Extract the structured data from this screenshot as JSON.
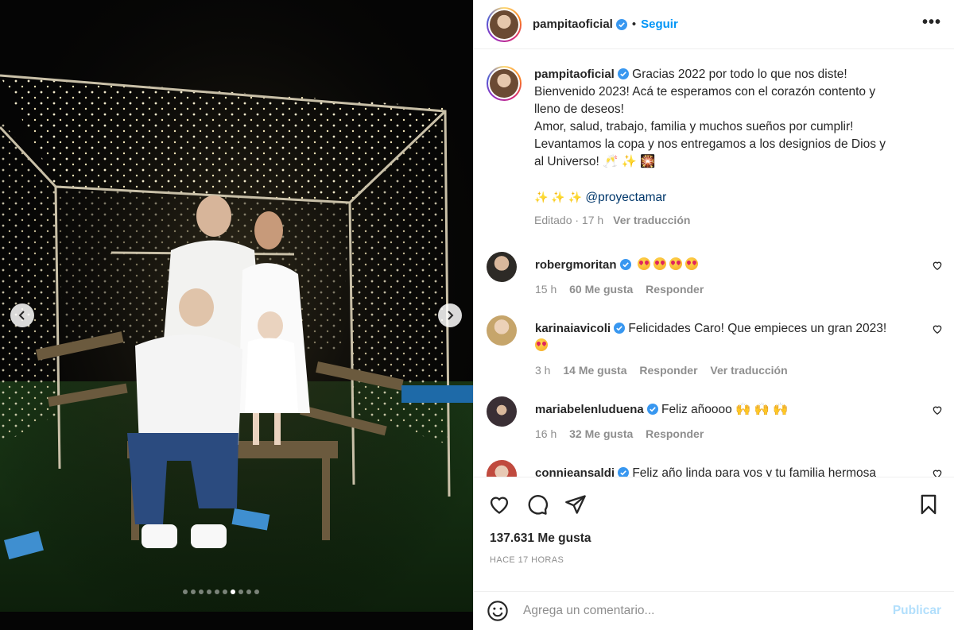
{
  "post": {
    "author": "pampitaoficial",
    "follow_label": "Seguir",
    "separator": "•",
    "more_label": "•••",
    "media_alt": "Foto de familia bajo una pérgola con luces",
    "carousel": {
      "total": 10,
      "active_index": 7
    }
  },
  "caption": {
    "author": "pampitaoficial",
    "lines": [
      "Gracias 2022 por todo lo que nos diste!",
      "Bienvenido 2023! Acá te esperamos con el corazón contento y",
      "lleno de deseos!",
      "Amor, salud, trabajo, familia y muchos sueños por cumplir!",
      "Levantamos la copa y nos entregamos a los designios de Dios y",
      "al Universo! 🥂 ✨ 🎇"
    ],
    "mention_prefix": "✨ ✨ ✨",
    "mention": "@proyectamar",
    "edited": "Editado · 17 h",
    "translate": "Ver traducción"
  },
  "comments": [
    {
      "user": "robergmoritan",
      "text": "",
      "emoji_count": 4,
      "time": "15 h",
      "likes": "60 Me gusta",
      "reply": "Responder",
      "translate": ""
    },
    {
      "user": "karinaiavicoli",
      "text": "Felicidades Caro! Que empieces un gran 2023!",
      "emoji_count": 1,
      "time": "3 h",
      "likes": "14 Me gusta",
      "reply": "Responder",
      "translate": "Ver traducción"
    },
    {
      "user": "mariabelenluduena",
      "text": "Feliz añoooo 🙌 🙌 🙌",
      "emoji_count": 0,
      "time": "16 h",
      "likes": "32 Me gusta",
      "reply": "Responder",
      "translate": ""
    },
    {
      "user": "connieansaldi",
      "text": "Feliz año linda para vos y tu familia hermosa",
      "emoji_count": 0,
      "time": "",
      "likes": "",
      "reply": "",
      "translate": ""
    }
  ],
  "stats": {
    "likes": "137.631 Me gusta",
    "time_ago": "HACE 17 HORAS"
  },
  "composer": {
    "placeholder": "Agrega un comentario...",
    "publish": "Publicar"
  },
  "colors": {
    "link": "#0095f6",
    "verified": "#3897f0",
    "muted": "#8e8e8e"
  }
}
